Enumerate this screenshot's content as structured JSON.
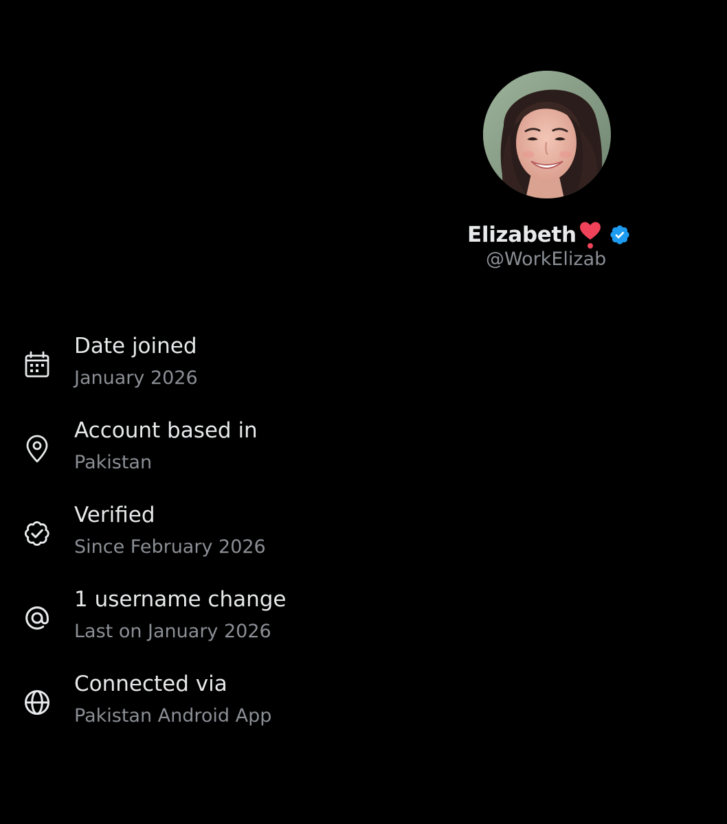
{
  "profile": {
    "display_name": "Elizabeth",
    "handle": "@WorkElizab",
    "emoji_icon": "heart-exclamation-icon",
    "verified_icon": "verified-badge-icon",
    "verified_color": "#1d9bf0"
  },
  "info_items": [
    {
      "icon": "calendar-icon",
      "title": "Date joined",
      "subtitle": "January 2026"
    },
    {
      "icon": "location-pin-icon",
      "title": "Account based in",
      "subtitle": "Pakistan"
    },
    {
      "icon": "verified-outline-icon",
      "title": "Verified",
      "subtitle": "Since February 2026"
    },
    {
      "icon": "at-sign-icon",
      "title": "1 username change",
      "subtitle": "Last on January 2026"
    },
    {
      "icon": "globe-icon",
      "title": "Connected via",
      "subtitle": "Pakistan Android App"
    }
  ],
  "colors": {
    "background": "#000000",
    "primary_text": "#e7e9ea",
    "secondary_text": "#8b8f95",
    "heart": "#f0435a"
  }
}
